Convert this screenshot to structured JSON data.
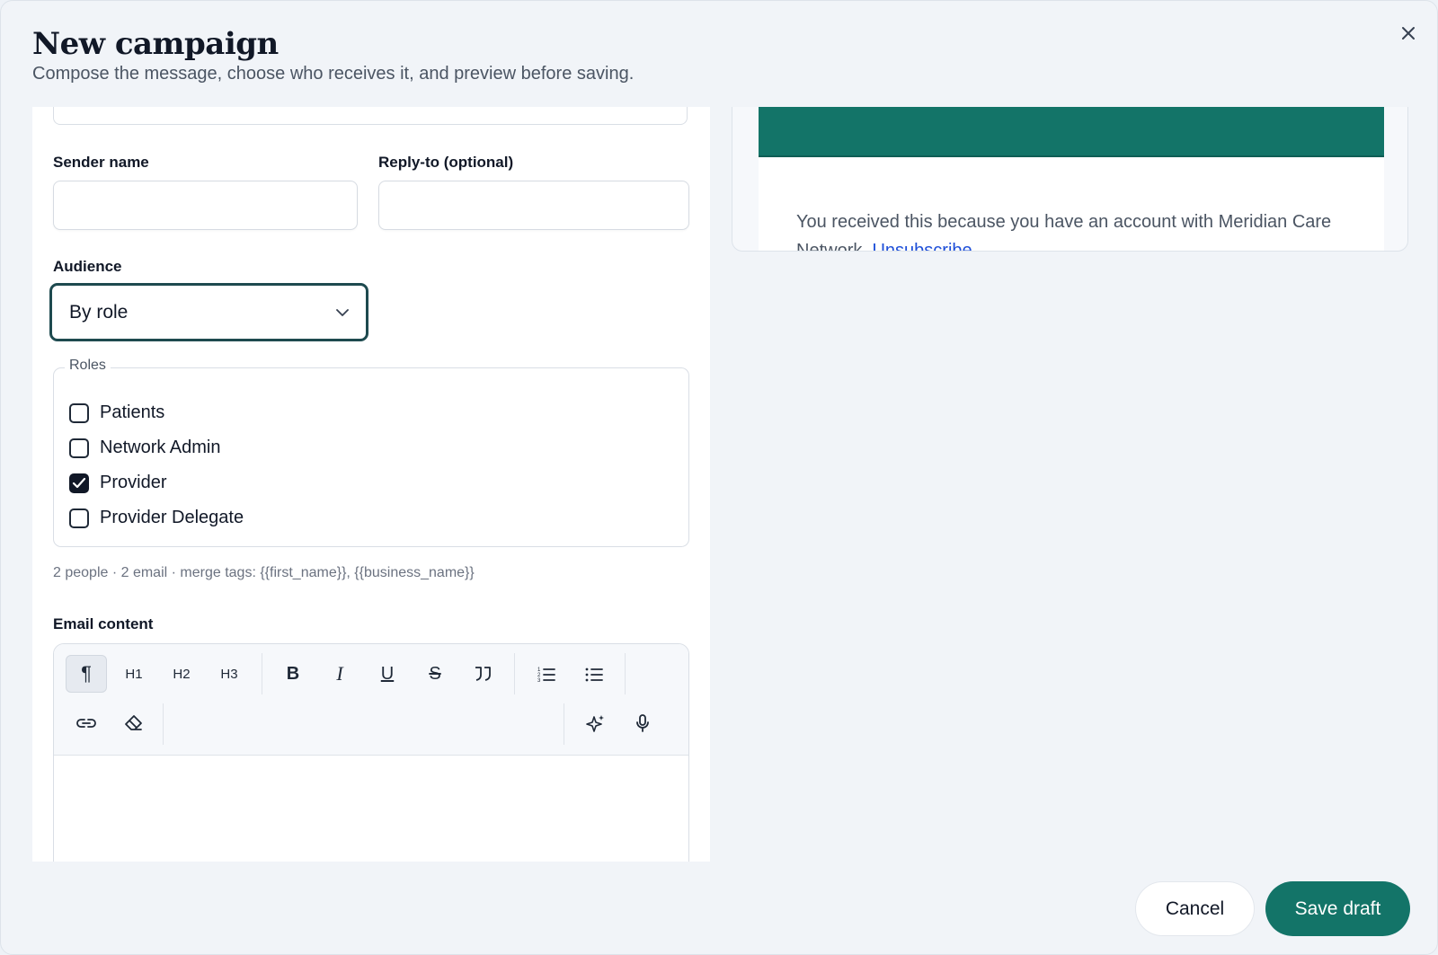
{
  "dialog": {
    "title": "New campaign",
    "subtitle": "Compose the message, choose who receives it, and preview before saving.",
    "close_icon": "close-icon"
  },
  "form": {
    "sender_name_label": "Sender name",
    "sender_name_value": "",
    "reply_to_label": "Reply-to (optional)",
    "reply_to_value": "",
    "audience_label": "Audience",
    "audience_value": "By role",
    "roles_legend": "Roles",
    "roles": [
      {
        "label": "Patients",
        "checked": false
      },
      {
        "label": "Network Admin",
        "checked": false
      },
      {
        "label": "Provider",
        "checked": true
      },
      {
        "label": "Provider Delegate",
        "checked": false
      }
    ],
    "helper_text": "2 people · 2 email · merge tags: {{first_name}}, {{business_name}}",
    "email_content_label": "Email content"
  },
  "toolbar": {
    "paragraph": "¶",
    "h1": "H1",
    "h2": "H2",
    "h3": "H3",
    "bold": "B",
    "italic": "I",
    "underline": "U",
    "strike": "S"
  },
  "preview": {
    "banner_color": "#137468",
    "footer_text": "You received this because you have an account with Meridian Care Network.",
    "unsubscribe_label": "Unsubscribe"
  },
  "actions": {
    "cancel_label": "Cancel",
    "save_label": "Save draft",
    "accent": "#137468"
  }
}
